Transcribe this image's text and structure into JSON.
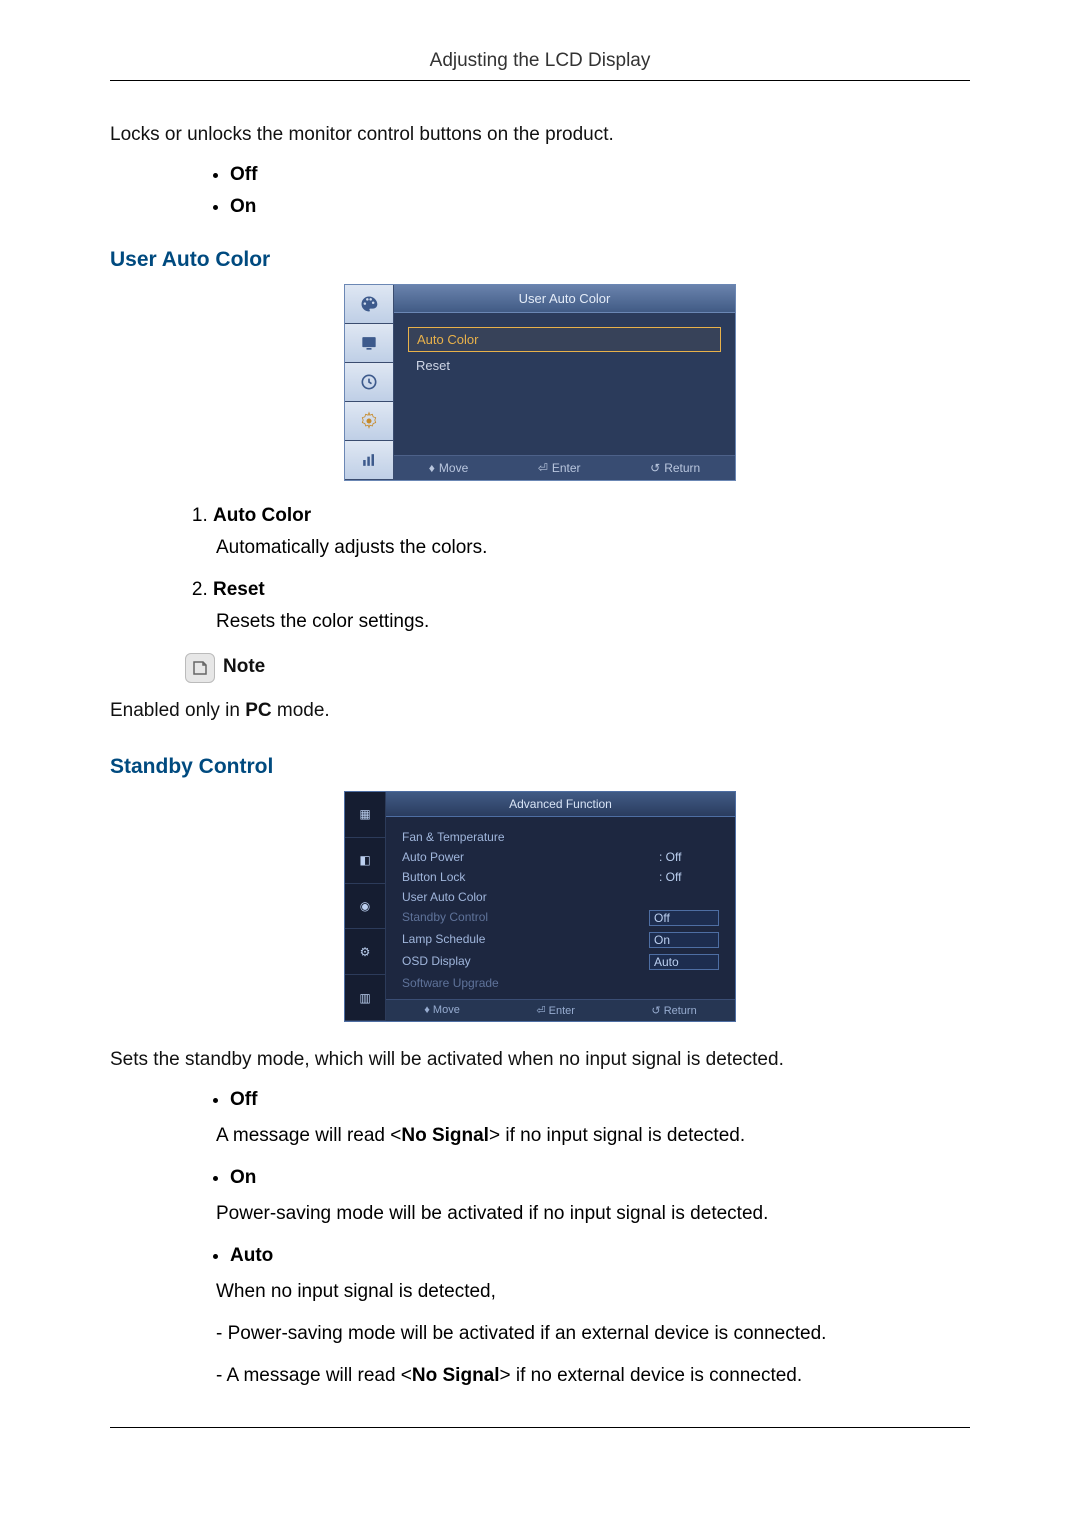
{
  "header": {
    "title": "Adjusting the LCD Display"
  },
  "intro": {
    "lock_text": "Locks or unlocks the monitor control buttons on the product.",
    "bullets": {
      "off": "Off",
      "on": "On"
    }
  },
  "sections": {
    "user_auto_color": {
      "heading": "User Auto Color",
      "osd": {
        "title": "User Auto Color",
        "items": {
          "auto_color": "Auto Color",
          "reset": "Reset"
        },
        "footer": {
          "move": "Move",
          "enter": "Enter",
          "return": "Return"
        }
      },
      "list": {
        "item1_label": "Auto Color",
        "item1_desc": "Automatically adjusts the colors.",
        "item2_label": "Reset",
        "item2_desc": "Resets the color settings."
      },
      "note": {
        "label": "Note",
        "text_before": "Enabled only in ",
        "bold": "PC",
        "text_after": " mode."
      }
    },
    "standby_control": {
      "heading": "Standby Control",
      "osd": {
        "title": "Advanced Function",
        "rows": [
          {
            "label": "Fan & Temperature",
            "value": ""
          },
          {
            "label": "Auto Power",
            "value": ": Off"
          },
          {
            "label": "Button Lock",
            "value": ": Off"
          },
          {
            "label": "User Auto Color",
            "value": ""
          },
          {
            "label": "Standby Control",
            "value": "Off"
          },
          {
            "label": "Lamp Schedule",
            "value": "On"
          },
          {
            "label": "OSD Display",
            "value": "Auto"
          },
          {
            "label": "Software Upgrade",
            "value": ""
          }
        ],
        "footer": {
          "move": "Move",
          "enter": "Enter",
          "return": "Return"
        }
      },
      "intro": "Sets the standby mode, which will be activated when no input signal is detected.",
      "bullets": {
        "off": {
          "label": "Off",
          "desc_before": "A message will read <",
          "desc_bold": "No Signal",
          "desc_after": "> if no input signal is detected."
        },
        "on": {
          "label": "On",
          "desc": "Power-saving mode will be activated if no input signal is detected."
        },
        "auto": {
          "label": "Auto",
          "desc1": "When no input signal is detected,",
          "desc2": "- Power-saving mode will be activated if an external device is connected.",
          "desc3_before": "- A message will read <",
          "desc3_bold": "No Signal",
          "desc3_after": "> if no external device is connected."
        }
      }
    }
  }
}
